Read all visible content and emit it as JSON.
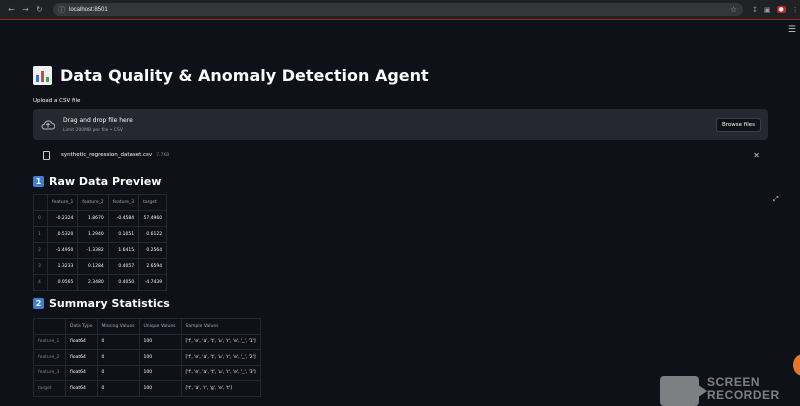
{
  "browser": {
    "url": "localhost:8501",
    "nav_icons": [
      "back-icon",
      "forward-icon",
      "reload-icon"
    ],
    "right_icons": [
      "star-icon",
      "download-icon",
      "extension-icon",
      "profile-icon",
      "menu-icon"
    ]
  },
  "app": {
    "title": "Data Quality & Anomaly Detection Agent",
    "title_icon": "bar-chart-emoji-icon",
    "upload": {
      "label": "Upload a CSV file",
      "drop_text": "Drag and drop file here",
      "limit_text": "Limit 200MB per file • CSV",
      "browse_label": "Browse files"
    },
    "file": {
      "name": "synthetic_regression_dataset.csv",
      "size": "7.7KB"
    },
    "section1": {
      "badge": "1",
      "title": "Raw Data Preview",
      "columns": [
        "",
        "feature_1",
        "feature_2",
        "feature_3",
        "target"
      ],
      "rows": [
        [
          "0",
          "-0.2324",
          "1.8670",
          "-0.4584",
          "57.4960"
        ],
        [
          "1",
          "0.5320",
          "1.2940",
          "0.1051",
          "0.6122"
        ],
        [
          "2",
          "-1.4950",
          "-1.3382",
          "1.6415",
          "0.2564"
        ],
        [
          "3",
          "1.3233",
          "0.1284",
          "0.4057",
          "2.6594"
        ],
        [
          "4",
          "0.0565",
          "2.3480",
          "0.4050",
          "-4.7439"
        ]
      ]
    },
    "section2": {
      "badge": "2",
      "title": "Summary Statistics",
      "columns": [
        "",
        "Data Type",
        "Missing Values",
        "Unique Values",
        "Sample Values"
      ],
      "rows": [
        [
          "feature_1",
          "float64",
          "0",
          "100",
          "['f', 'e', 'a', 't', 'u', 'r', 'e', '_', '1']"
        ],
        [
          "feature_2",
          "float64",
          "0",
          "100",
          "['f', 'e', 'a', 't', 'u', 'r', 'e', '_', '2']"
        ],
        [
          "feature_3",
          "float64",
          "0",
          "100",
          "['f', 'e', 'a', 't', 'u', 'r', 'e', '_', '3']"
        ],
        [
          "target",
          "float64",
          "0",
          "100",
          "['t', 'a', 'r', 'g', 'e', 't']"
        ]
      ]
    }
  },
  "watermark": {
    "line1": "SCREEN",
    "line2": "RECORDER"
  },
  "colors": {
    "background": "#0e1117",
    "dropzone": "#262730",
    "badge": "#3d7ed6"
  }
}
